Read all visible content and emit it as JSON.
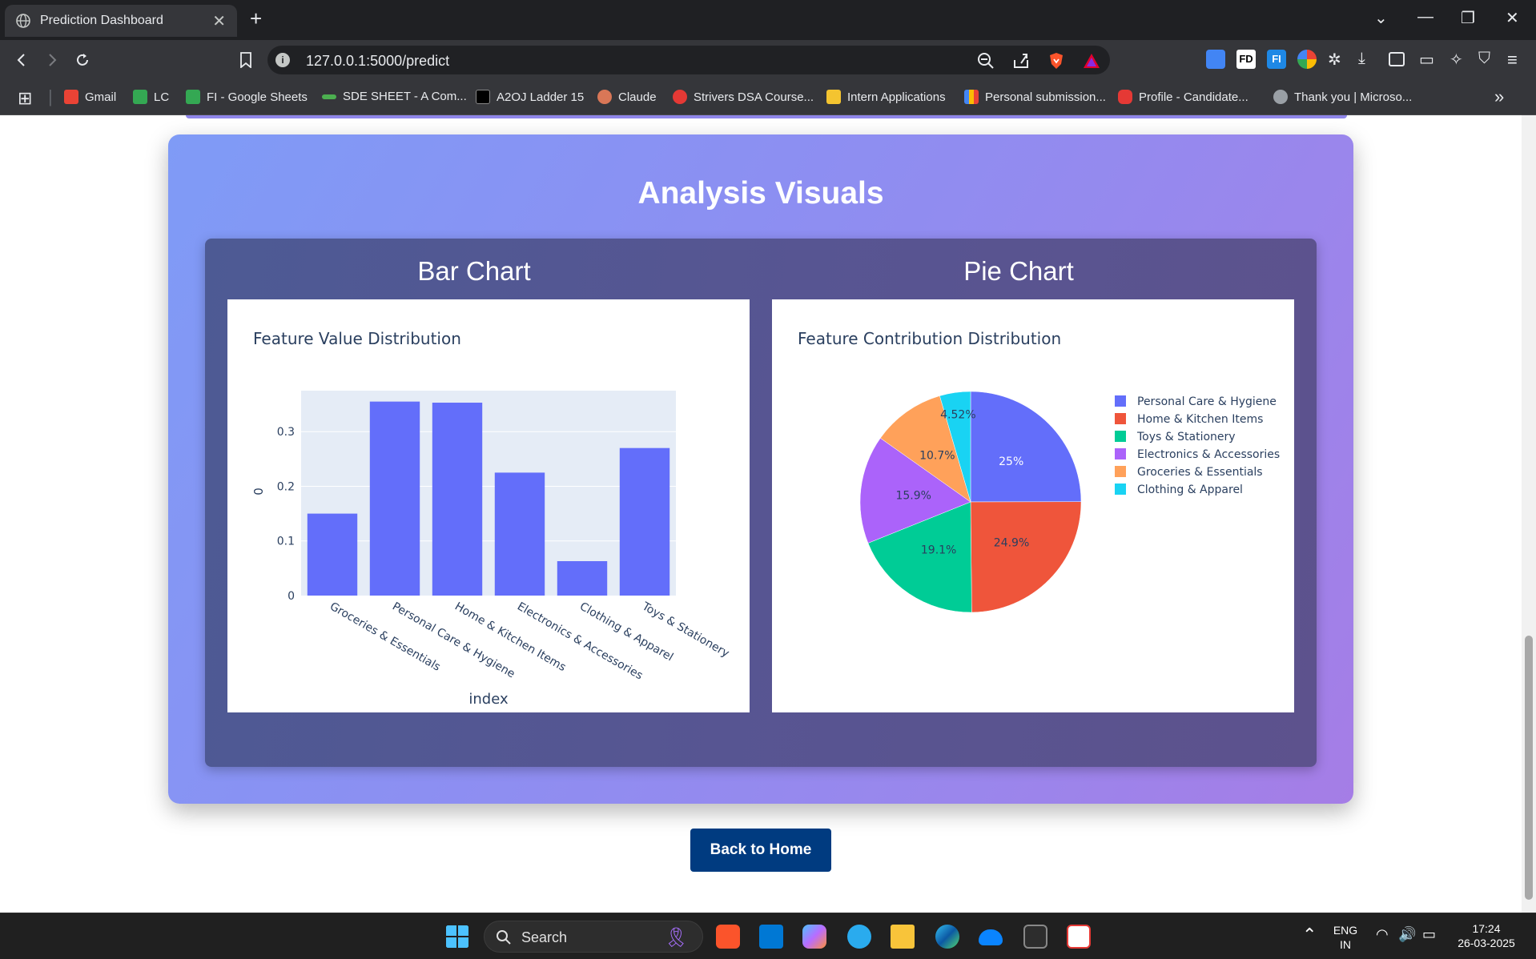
{
  "browser": {
    "tab_title": "Prediction Dashboard",
    "url": "127.0.0.1:5000/predict",
    "bookmarks": [
      {
        "label": "Gmail",
        "color": "#ea4335"
      },
      {
        "label": "LC",
        "color": "#34a853"
      },
      {
        "label": "FI - Google Sheets",
        "color": "#34a853"
      },
      {
        "label": "SDE SHEET - A Com...",
        "color": "#4caf50"
      },
      {
        "label": "A2OJ Ladder 15",
        "color": "#000000"
      },
      {
        "label": "Claude",
        "color": "#d97757"
      },
      {
        "label": "Strivers DSA Course...",
        "color": "#e53935"
      },
      {
        "label": "Intern Applications",
        "color": "#f4c430"
      },
      {
        "label": "Personal submission...",
        "color": "#fbbc04"
      },
      {
        "label": "Profile - Candidate...",
        "color": "#e53935"
      },
      {
        "label": "Thank you | Microso...",
        "color": "#9aa0a6"
      }
    ]
  },
  "page": {
    "section_title": "Analysis Visuals",
    "bar_heading": "Bar Chart",
    "pie_heading": "Pie Chart",
    "back_button": "Back to Home"
  },
  "chart_data": [
    {
      "type": "bar",
      "title": "Feature Value Distribution",
      "xlabel": "index",
      "ylabel": "0",
      "categories": [
        "Groceries & Essentials",
        "Personal Care & Hygiene",
        "Home & Kitchen Items",
        "Electronics & Accessories",
        "Clothing & Apparel",
        "Toys & Stationery"
      ],
      "values": [
        0.15,
        0.355,
        0.353,
        0.225,
        0.063,
        0.27
      ],
      "yticks": [
        "0",
        "0.1",
        "0.2",
        "0.3"
      ],
      "ylim": [
        0,
        0.375
      ],
      "color": "#636efa",
      "plot_bg": "#e5ecf6"
    },
    {
      "type": "pie",
      "title": "Feature Contribution Distribution",
      "legend_position": "right",
      "slices": [
        {
          "label": "Personal Care & Hygiene",
          "value": 25,
          "text": "25%",
          "color": "#636efa",
          "text_color": "#ffffff"
        },
        {
          "label": "Home & Kitchen Items",
          "value": 24.9,
          "text": "24.9%",
          "color": "#ef553b",
          "text_color": "#2a3f5f"
        },
        {
          "label": "Toys & Stationery",
          "value": 19.1,
          "text": "19.1%",
          "color": "#00cc96",
          "text_color": "#2a3f5f"
        },
        {
          "label": "Electronics & Accessories",
          "value": 15.9,
          "text": "15.9%",
          "color": "#ab63fa",
          "text_color": "#2a3f5f"
        },
        {
          "label": "Groceries & Essentials",
          "value": 10.7,
          "text": "10.7%",
          "color": "#ffa15a",
          "text_color": "#2a3f5f"
        },
        {
          "label": "Clothing & Apparel",
          "value": 4.52,
          "text": "4.52%",
          "color": "#19d3f3",
          "text_color": "#2a3f5f"
        }
      ]
    }
  ],
  "taskbar": {
    "search_label": "Search",
    "lang_line1": "ENG",
    "lang_line2": "IN",
    "time": "17:24",
    "date": "26-03-2025"
  }
}
